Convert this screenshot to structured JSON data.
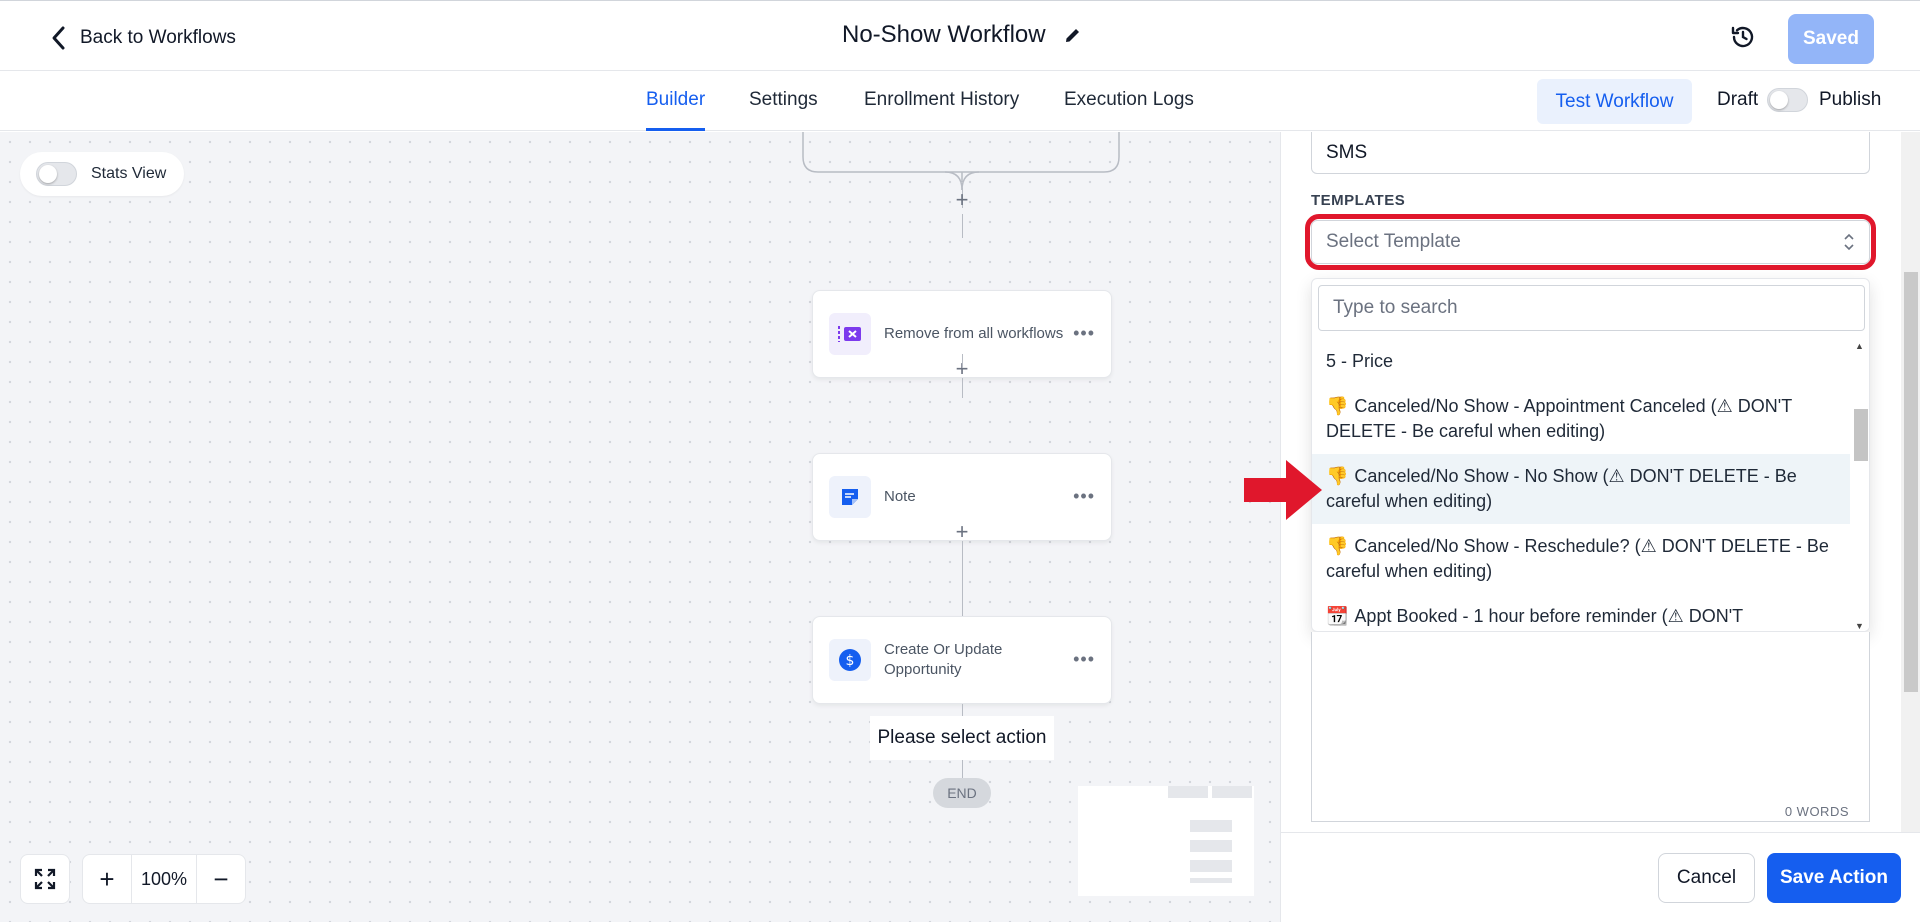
{
  "header": {
    "back_label": "Back to Workflows",
    "workflow_title": "No-Show Workflow",
    "saved_label": "Saved"
  },
  "tabs": [
    {
      "label": "Builder",
      "active": true
    },
    {
      "label": "Settings",
      "active": false
    },
    {
      "label": "Enrollment History",
      "active": false
    },
    {
      "label": "Execution Logs",
      "active": false
    }
  ],
  "toolbar": {
    "test_workflow_label": "Test Workflow",
    "draft_label": "Draft",
    "publish_label": "Publish",
    "publish_toggle_on": false
  },
  "canvas": {
    "stats_view_label": "Stats View",
    "stats_view_on": false,
    "nodes": [
      {
        "label": "Remove from all workflows",
        "icon": "remove-workflow-icon"
      },
      {
        "label": "Note",
        "icon": "note-icon"
      },
      {
        "label": "Create Or Update Opportunity",
        "icon": "dollar-icon"
      }
    ],
    "please_select_action": "Please select action",
    "end_label": "END",
    "zoom_level": "100%"
  },
  "panel": {
    "channel_value": "SMS",
    "templates_label": "TEMPLATES",
    "template_placeholder": "Select Template",
    "search_placeholder": "Type to search",
    "template_options": [
      {
        "emoji": "",
        "text": "5 - Price",
        "active": false
      },
      {
        "emoji": "👎",
        "text": "Canceled/No Show - Appointment Canceled (⚠ DON'T DELETE - Be careful when editing)",
        "active": false
      },
      {
        "emoji": "👎",
        "text": "Canceled/No Show - No Show (⚠ DON'T DELETE - Be careful when editing)",
        "active": true
      },
      {
        "emoji": "👎",
        "text": "Canceled/No Show - Reschedule? (⚠ DON'T DELETE - Be careful when editing)",
        "active": false
      },
      {
        "emoji": "📆",
        "text": "Appt Booked - 1 hour before reminder (⚠ DON'T",
        "active": false
      }
    ],
    "word_count": "0 WORDS",
    "cancel_label": "Cancel",
    "save_action_label": "Save Action"
  },
  "colors": {
    "primary": "#155eef",
    "annotation_red": "#e0172c"
  }
}
